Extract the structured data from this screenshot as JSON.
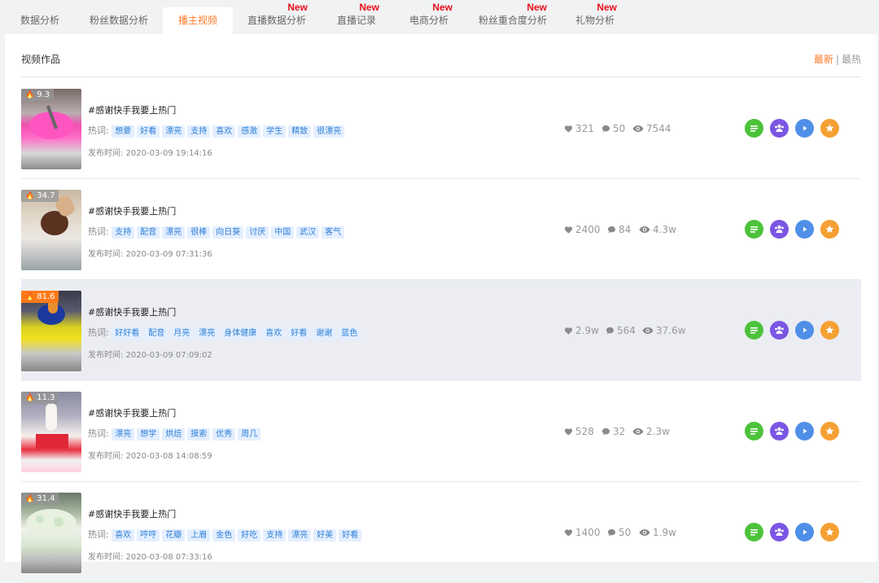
{
  "tabs": [
    {
      "label": "数据分析",
      "new": ""
    },
    {
      "label": "粉丝数据分析",
      "new": ""
    },
    {
      "label": "播主视频",
      "new": ""
    },
    {
      "label": "直播数据分析",
      "new": "New"
    },
    {
      "label": "直播记录",
      "new": "New"
    },
    {
      "label": "电商分析",
      "new": "New"
    },
    {
      "label": "粉丝重合度分析",
      "new": "New"
    },
    {
      "label": "礼物分析",
      "new": "New"
    }
  ],
  "panel": {
    "title": "视频作品",
    "sort_latest": "最新",
    "sort_sep": "|",
    "sort_hot": "最热"
  },
  "hot_label": "热词:",
  "date_label": "发布时间:",
  "colors": {
    "accent": "#ff7a2a",
    "new_badge": "#e8101a",
    "tag_text": "#2e7fd6",
    "btn_green": "#4cc23a",
    "btn_purple": "#7b56e3",
    "btn_blue": "#4f8fe8",
    "btn_orange": "#f5a033"
  },
  "videos": [
    {
      "score": "9.3",
      "title": "#感谢快手我要上热门",
      "tags": [
        "想要",
        "好看",
        "漂亮",
        "支持",
        "喜欢",
        "感激",
        "学生",
        "精致",
        "很漂亮"
      ],
      "date": "2020-03-09 19:14:16",
      "likes": "321",
      "comments": "50",
      "views": "7544"
    },
    {
      "score": "34.7",
      "title": "#感谢快手我要上热门",
      "tags": [
        "支持",
        "配音",
        "漂亮",
        "很棒",
        "向日葵",
        "讨厌",
        "中国",
        "武汉",
        "客气"
      ],
      "date": "2020-03-09 07:31:36",
      "likes": "2400",
      "comments": "84",
      "views": "4.3w"
    },
    {
      "score": "81.6",
      "title": "#感谢快手我要上热门",
      "tags": [
        "好好看",
        "配音",
        "月亮",
        "漂亮",
        "身体健康",
        "喜欢",
        "好看",
        "谢谢",
        "蓝色"
      ],
      "date": "2020-03-09 07:09:02",
      "likes": "2.9w",
      "comments": "564",
      "views": "37.6w"
    },
    {
      "score": "11.3",
      "title": "#感谢快手我要上热门",
      "tags": [
        "漂亮",
        "想学",
        "烘焙",
        "摸索",
        "优秀",
        "周几"
      ],
      "date": "2020-03-08 14:08:59",
      "likes": "528",
      "comments": "32",
      "views": "2.3w"
    },
    {
      "score": "31.4",
      "title": "#感谢快手我要上热门",
      "tags": [
        "喜欢",
        "哼哼",
        "花瓣",
        "上眉",
        "金色",
        "好吃",
        "支持",
        "漂亮",
        "好美",
        "好看"
      ],
      "date": "2020-03-08 07:33:16",
      "likes": "1400",
      "comments": "50",
      "views": "1.9w"
    }
  ]
}
